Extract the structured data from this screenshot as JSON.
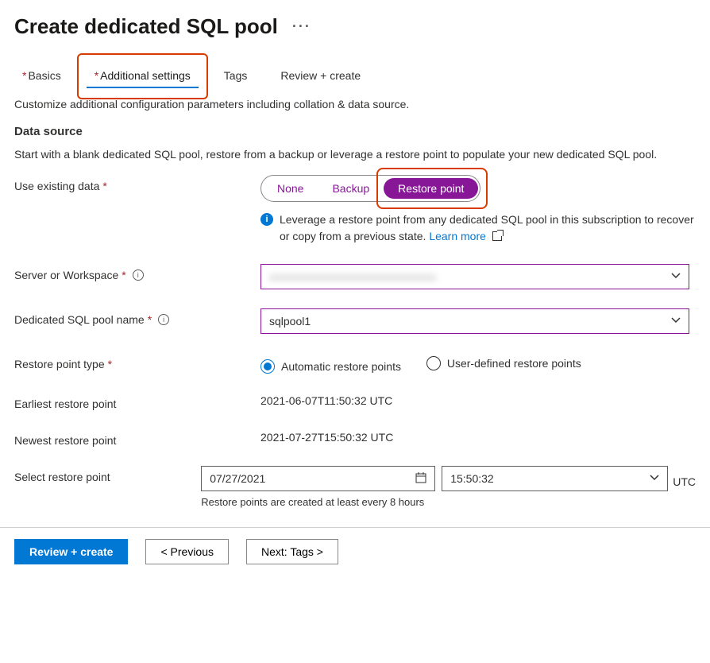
{
  "header": {
    "title": "Create dedicated SQL pool"
  },
  "tabs": {
    "basics": "Basics",
    "additional": "Additional settings",
    "tags": "Tags",
    "review": "Review + create"
  },
  "intro": "Customize additional configuration parameters including collation & data source.",
  "section": {
    "title": "Data source",
    "desc": "Start with a blank dedicated SQL pool, restore from a backup or leverage a restore point to populate your new dedicated SQL pool."
  },
  "use_existing": {
    "label": "Use existing data",
    "options": {
      "none": "None",
      "backup": "Backup",
      "restore": "Restore point"
    },
    "blurb": "Leverage a restore point from any dedicated SQL pool in this subscription to recover or copy from a previous state. ",
    "learn_more": "Learn more"
  },
  "server": {
    "label": "Server or Workspace",
    "value_masked": "xxxxxxxxxxxxxxxxxxxxxxxxxxxxxx"
  },
  "pool_name": {
    "label": "Dedicated SQL pool name",
    "value": "sqlpool1"
  },
  "restore_type": {
    "label": "Restore point type",
    "auto": "Automatic restore points",
    "user": "User-defined restore points"
  },
  "earliest": {
    "label": "Earliest restore point",
    "value": "2021-06-07T11:50:32 UTC"
  },
  "newest": {
    "label": "Newest restore point",
    "value": "2021-07-27T15:50:32 UTC"
  },
  "select_rp": {
    "label": "Select restore point",
    "date": "07/27/2021",
    "time": "15:50:32",
    "tz": "UTC",
    "hint": "Restore points are created at least every 8 hours"
  },
  "footer": {
    "review": "Review + create",
    "prev": "<  Previous",
    "next": "Next: Tags  >"
  }
}
